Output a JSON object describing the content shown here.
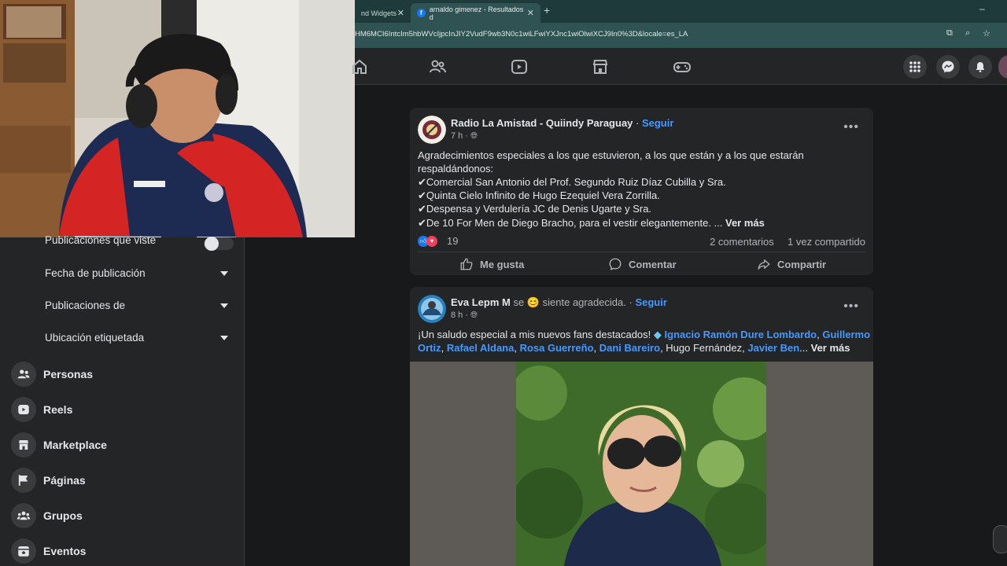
{
  "browser": {
    "tabs": [
      {
        "title": "nd Widgets"
      },
      {
        "title": "arnaldo gimenez - Resultados d"
      }
    ],
    "url": "HM6MCI6IntcIm5hbWVcIjpcInJIY2VudF9wb3N0c1wiLFwiYXJnc1wiOlwiXCJ9In0%3D&locale=es_LA",
    "icons": [
      "close-icon",
      "plus-icon",
      "minimize-icon",
      "cast-icon",
      "zoom-icon",
      "star-icon"
    ]
  },
  "fb_nav": {
    "icons": [
      "home-icon",
      "friends-icon",
      "video-icon",
      "marketplace-icon",
      "gaming-icon",
      "menu-grid-icon",
      "messenger-icon",
      "bell-icon"
    ]
  },
  "sidebar": {
    "filters": [
      {
        "label": "Publicaciones que viste",
        "type": "toggle"
      },
      {
        "label": "Fecha de publicación",
        "type": "dropdown"
      },
      {
        "label": "Publicaciones de",
        "type": "dropdown"
      },
      {
        "label": "Ubicación etiquetada",
        "type": "dropdown"
      }
    ],
    "items": [
      {
        "label": "Personas",
        "icon": "people-icon"
      },
      {
        "label": "Reels",
        "icon": "reels-icon"
      },
      {
        "label": "Marketplace",
        "icon": "shop-icon"
      },
      {
        "label": "Páginas",
        "icon": "flag-icon"
      },
      {
        "label": "Grupos",
        "icon": "groups-icon"
      },
      {
        "label": "Eventos",
        "icon": "calendar-icon"
      }
    ]
  },
  "posts": [
    {
      "author": "Radio La Amistad - Quiindy Paraguay",
      "sep": " · ",
      "follow": "Seguir",
      "time": "7 h ·",
      "lines": [
        "Agradecimientos especiales a los que estuvieron, a los que están y a los que estarán",
        "respaldándonos:",
        "✔Comercial San Antonio del Prof. Segundo Ruiz Díaz Cubilla y Sra.",
        "✔Quinta Cielo Infinito de Hugo Ezequiel Vera Zorrilla.",
        "✔Despensa y Verdulería  JC  de Denis Ugarte y Sra.",
        "✔De 10 For Men de Diego Bracho, para el vestir elegantemente. ..."
      ],
      "see_more": "Ver más",
      "reactions": "19",
      "comments": "2 comentarios",
      "shares": "1 vez compartido",
      "actions": {
        "like": "Me gusta",
        "comment": "Comentar",
        "share": "Compartir"
      }
    },
    {
      "author": "Eva Lepm M",
      "feeling_pre": " se ",
      "feeling": "siente agradecida.",
      "sep": " · ",
      "follow": "Seguir",
      "time": "8 h ·",
      "text_start": "¡Un saludo especial a mis nuevos fans destacados! ",
      "fans": [
        "Ignacio Ramón Dure Lombardo",
        "Guillermo",
        "Ortiz",
        "Rafael Aldana",
        "Rosa Guerreño",
        "Dani Bareiro",
        "Javier Ben"
      ],
      "plain_fan": "Hugo Fernández",
      "comma": ", ",
      "ellipsis": "...",
      "see_more": "Ver más"
    }
  ],
  "colors": {
    "link": "#4599ff",
    "bg": "#18191a",
    "card": "#242526",
    "tab_bar": "#1f3a3a"
  }
}
